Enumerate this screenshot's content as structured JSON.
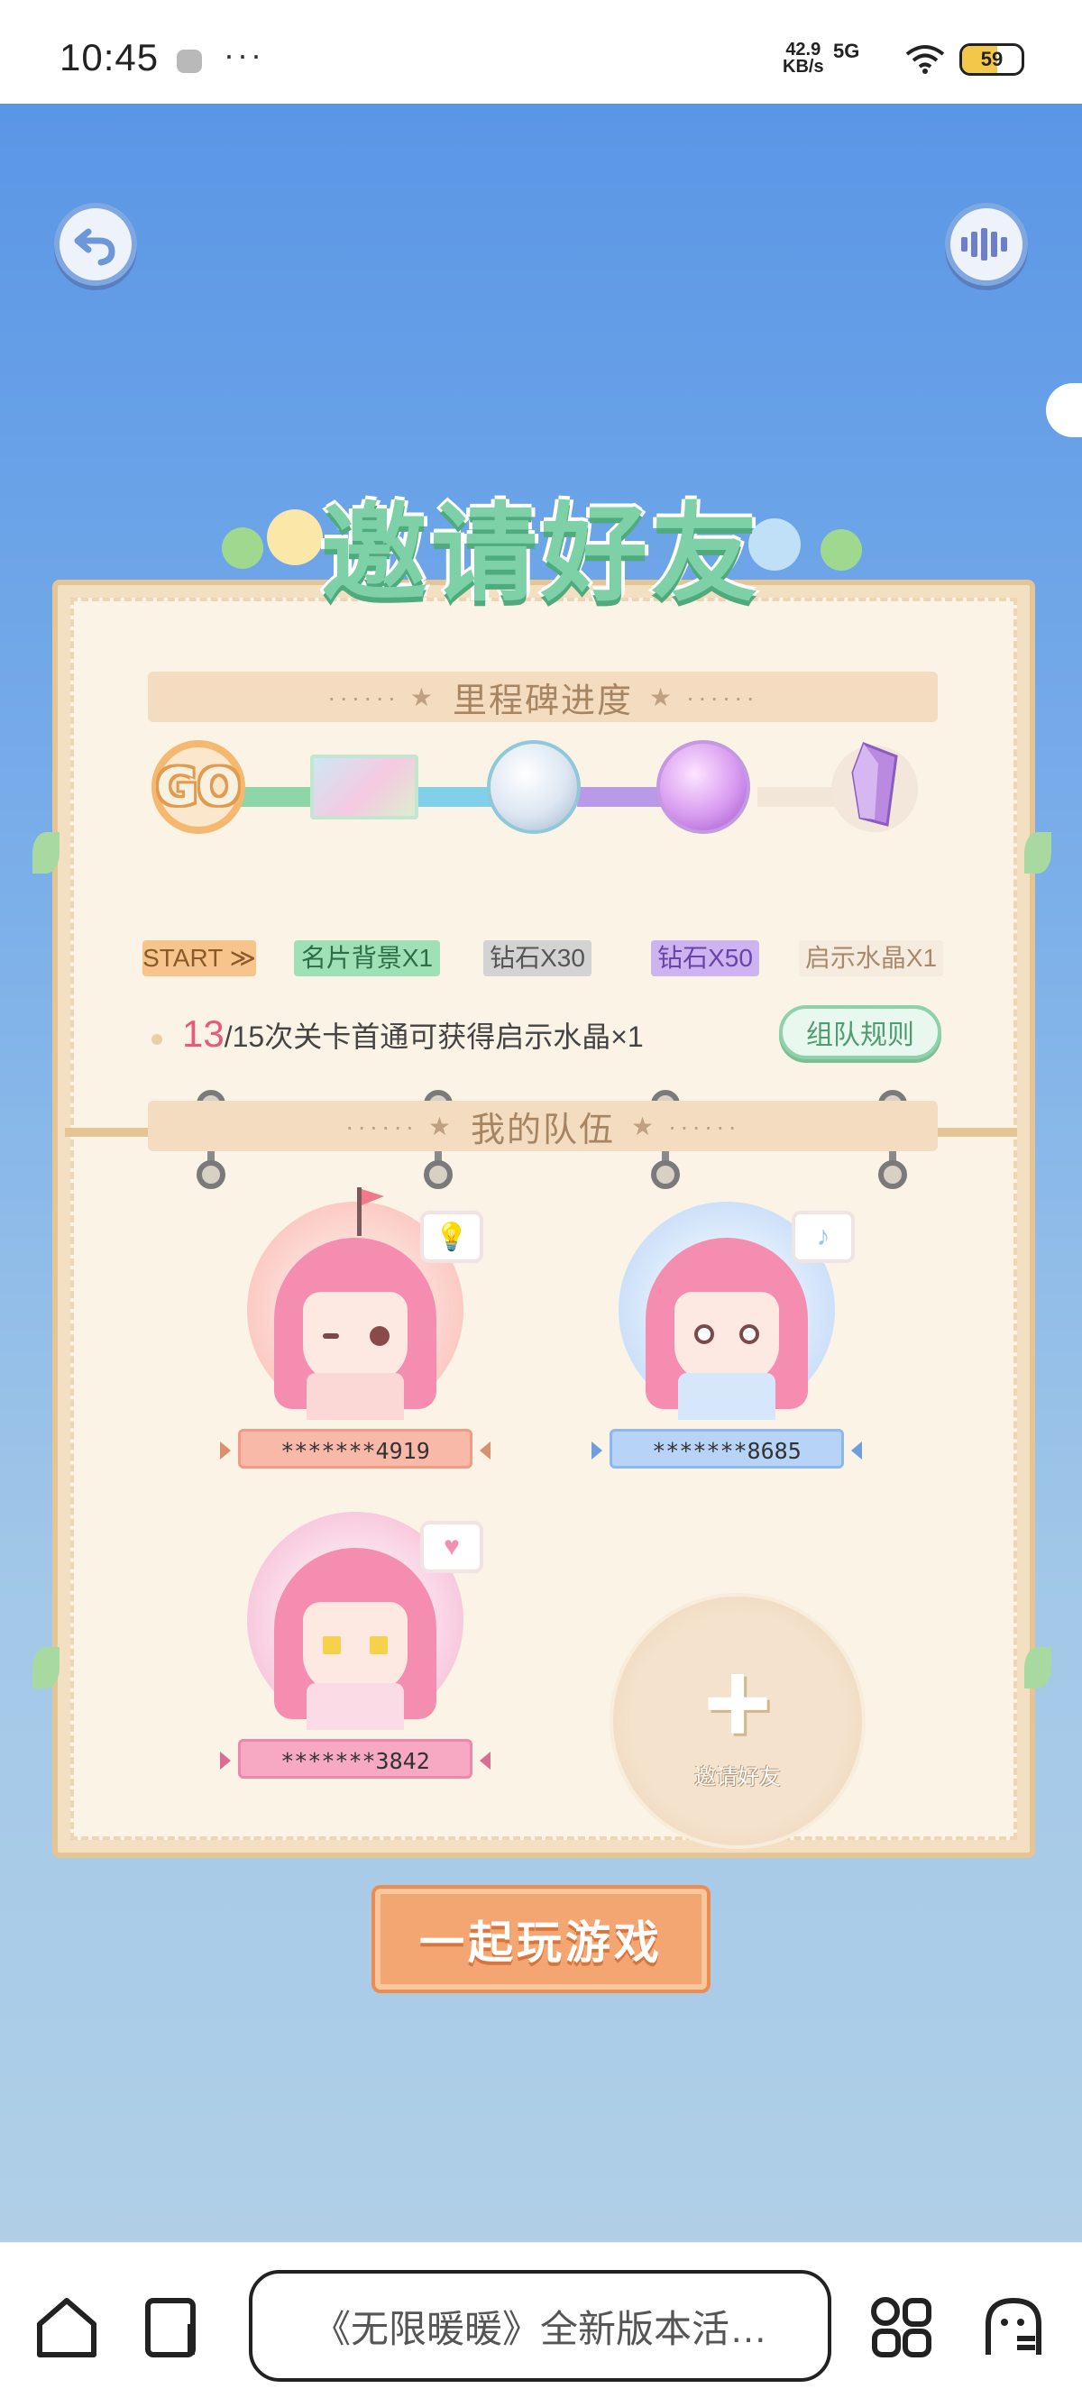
{
  "status_bar": {
    "time": "10:45",
    "more": "···",
    "net_speed": "42.9",
    "net_unit": "KB/s",
    "network": "5G",
    "battery": "59",
    "battery_level": 0.59
  },
  "game": {
    "title": "邀请好友",
    "milestone": {
      "header": "里程碑进度",
      "go_label": "GO",
      "rewards": [
        {
          "label": "START ≫",
          "icon": "go-start-icon"
        },
        {
          "label": "名片背景X1",
          "icon": "card-background-icon"
        },
        {
          "label": "钻石X30",
          "icon": "clear-diamond-icon"
        },
        {
          "label": "钻石X50",
          "icon": "purple-diamond-icon"
        },
        {
          "label": "启示水晶X1",
          "icon": "crystal-icon"
        }
      ],
      "progress_current": "13",
      "progress_text": "/15次关卡首通可获得启示水晶×1",
      "rules_button": "组队规则"
    },
    "team": {
      "header": "我的队伍",
      "members": [
        {
          "name": "*******4919",
          "bubble_icon": "lightbulb-icon",
          "leader": true
        },
        {
          "name": "*******8685",
          "bubble_icon": "music-note-icon",
          "leader": false
        },
        {
          "name": "*******3842",
          "bubble_icon": "heart-icon",
          "leader": false
        }
      ],
      "invite_label": "邀请好友"
    },
    "play_button": "一起玩游戏"
  },
  "bottom_nav": {
    "search_text": "《无限暖暖》全新版本活…",
    "icons": [
      "home-icon",
      "tabs-icon",
      "apps-icon",
      "ghost-icon"
    ]
  },
  "colors": {
    "sky_top": "#5a96e6",
    "sky_bottom": "#b0cfe7",
    "title_green": "#7ed1a7",
    "accent_orange": "#f4a672",
    "progress_pink": "#e55b7b"
  }
}
